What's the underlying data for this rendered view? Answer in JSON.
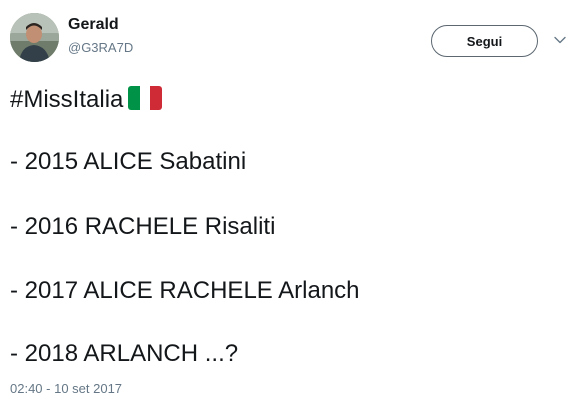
{
  "tweet": {
    "author": {
      "name": "Gerald",
      "handle": "@G3RA7D",
      "avatar_icon": "user-avatar"
    },
    "follow_label": "Segui",
    "menu_icon": "chevron-down-icon",
    "lines": [
      "#MissItalia",
      "- 2015 ALICE Sabatini",
      "- 2016 RACHELE Risaliti",
      "- 2017 ALICE RACHELE Arlanch",
      "- 2018 ARLANCH ...?"
    ],
    "flag_icon": "italy-flag-emoji",
    "flag_colors": [
      "#009246",
      "#ffffff",
      "#ce2b37"
    ],
    "timestamp": "02:40 - 10 set 2017"
  },
  "colors": {
    "text_primary": "#14171a",
    "text_secondary": "#657786",
    "button_border": "#5c6770"
  }
}
